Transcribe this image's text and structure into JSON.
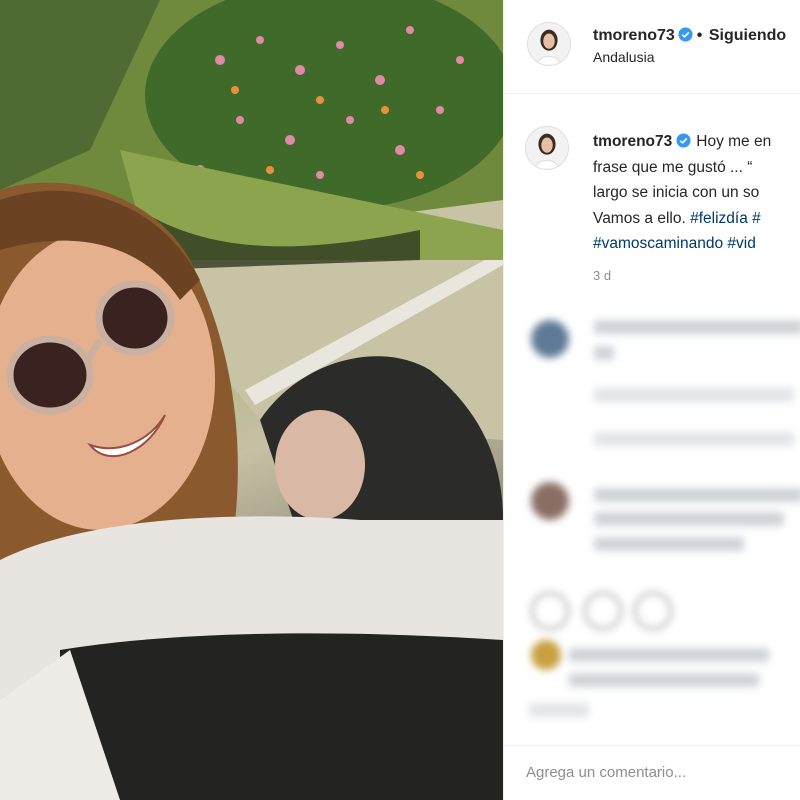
{
  "post": {
    "username": "tmoreno73",
    "follow_status": "Siguiendo",
    "location": "Andalusia",
    "caption": {
      "line1": "Hoy me en",
      "line2": "frase que me gustó ... “",
      "line3": "largo se inicia con un so",
      "line4": "Vamos a ello. ",
      "hashtag1": "#felizdía #",
      "hashtag2": "#vamoscaminando #vid"
    },
    "timestamp": "3 d"
  },
  "comment_box": {
    "placeholder": "Agrega un comentario..."
  },
  "icons": {
    "verified": "verified-badge-icon",
    "separator": "•"
  },
  "colors": {
    "verified_blue": "#3897f0",
    "hashtag": "#00376b",
    "muted_text": "#8e8e8e",
    "border": "#efefef"
  }
}
